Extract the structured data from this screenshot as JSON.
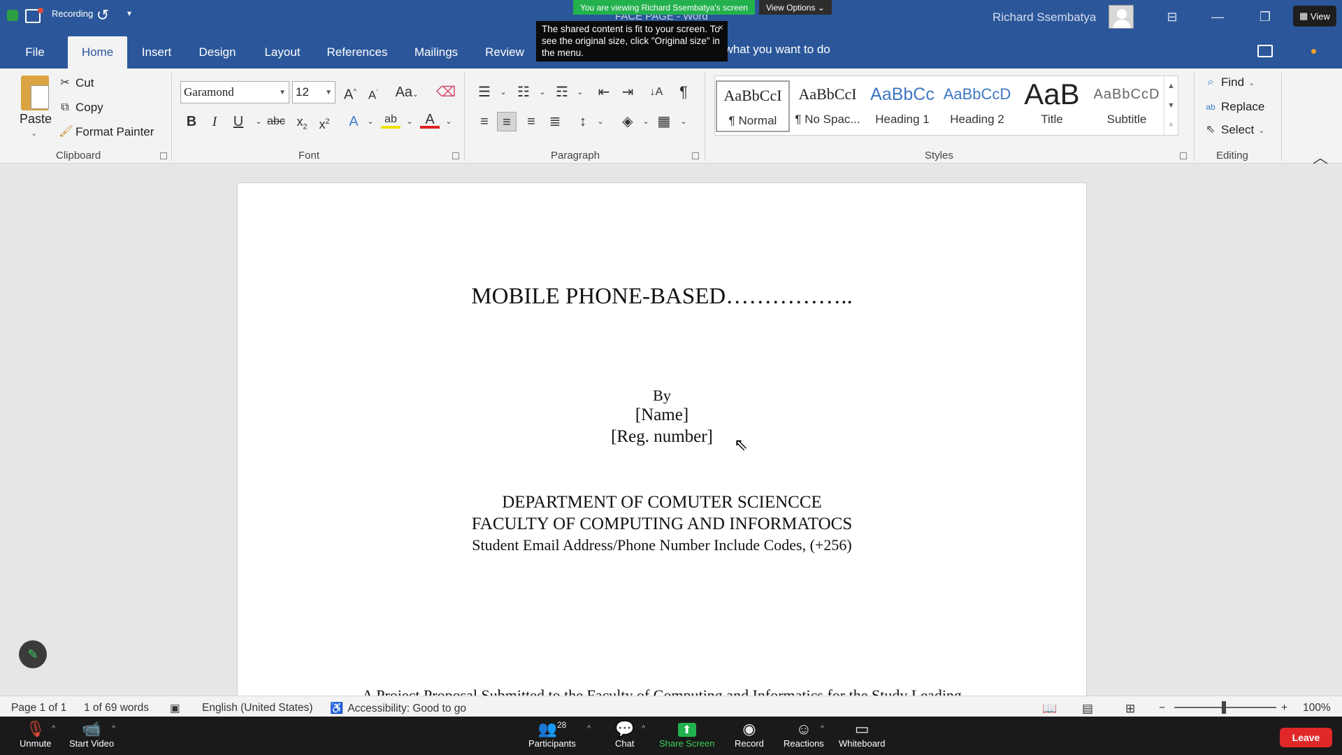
{
  "titlebar": {
    "recording_label": "Recording",
    "doc_title": "FACE PAGE  -  Word",
    "share_banner": "You are viewing Richard Ssembatya's screen",
    "view_options": "View Options",
    "user_name": "Richard Ssembatya",
    "view_button": "View"
  },
  "tooltip": {
    "text": "The shared content is fit to your screen. To see the original size, click \"Original size\" in the menu.",
    "close": "×"
  },
  "tabs": [
    {
      "label": "File"
    },
    {
      "label": "Home"
    },
    {
      "label": "Insert"
    },
    {
      "label": "Design"
    },
    {
      "label": "Layout"
    },
    {
      "label": "References"
    },
    {
      "label": "Mailings"
    },
    {
      "label": "Review"
    }
  ],
  "tell_me": "Tell me what you want to do",
  "clipboard": {
    "paste": "Paste",
    "cut": "Cut",
    "copy": "Copy",
    "format_painter": "Format Painter",
    "group": "Clipboard"
  },
  "font": {
    "name": "Garamond",
    "size": "12",
    "group": "Font"
  },
  "paragraph": {
    "group": "Paragraph"
  },
  "styles": {
    "group": "Styles",
    "items": [
      {
        "sample": "AaBbCcI",
        "name": "¶ Normal"
      },
      {
        "sample": "AaBbCcI",
        "name": "¶ No Spac..."
      },
      {
        "sample": "AaBbCc",
        "name": "Heading 1"
      },
      {
        "sample": "AaBbCcD",
        "name": "Heading 2"
      },
      {
        "sample": "AaB",
        "name": "Title"
      },
      {
        "sample": "AaBbCcD",
        "name": "Subtitle"
      }
    ]
  },
  "editing": {
    "find": "Find",
    "replace": "Replace",
    "select": "Select",
    "group": "Editing"
  },
  "document": {
    "title": "MOBILE PHONE-BASED……………..",
    "by": "By",
    "name": "[Name]",
    "reg": "[Reg. number]",
    "dept": "DEPARTMENT OF COMUTER SCIENCCE",
    "faculty": "FACULTY OF COMPUTING AND INFORMATOCS",
    "email": "Student Email Address/Phone Number Include Codes, (+256)",
    "partial_line": "A Project Proposal Submitted to the Faculty of Computing and Informatics for the Study Leading"
  },
  "status": {
    "page": "Page 1 of 1",
    "words": "1 of 69 words",
    "language": "English (United States)",
    "accessibility": "Accessibility: Good to go",
    "zoom": "100%"
  },
  "zoom_meeting": {
    "unmute": "Unmute",
    "start_video": "Start Video",
    "participants": "Participants",
    "participants_count": "28",
    "chat": "Chat",
    "share_screen": "Share Screen",
    "record": "Record",
    "reactions": "Reactions",
    "whiteboard": "Whiteboard",
    "leave": "Leave"
  },
  "colors": {
    "word_blue": "#2b579a",
    "zoom_green": "#23b14d",
    "leave_red": "#e02828"
  }
}
